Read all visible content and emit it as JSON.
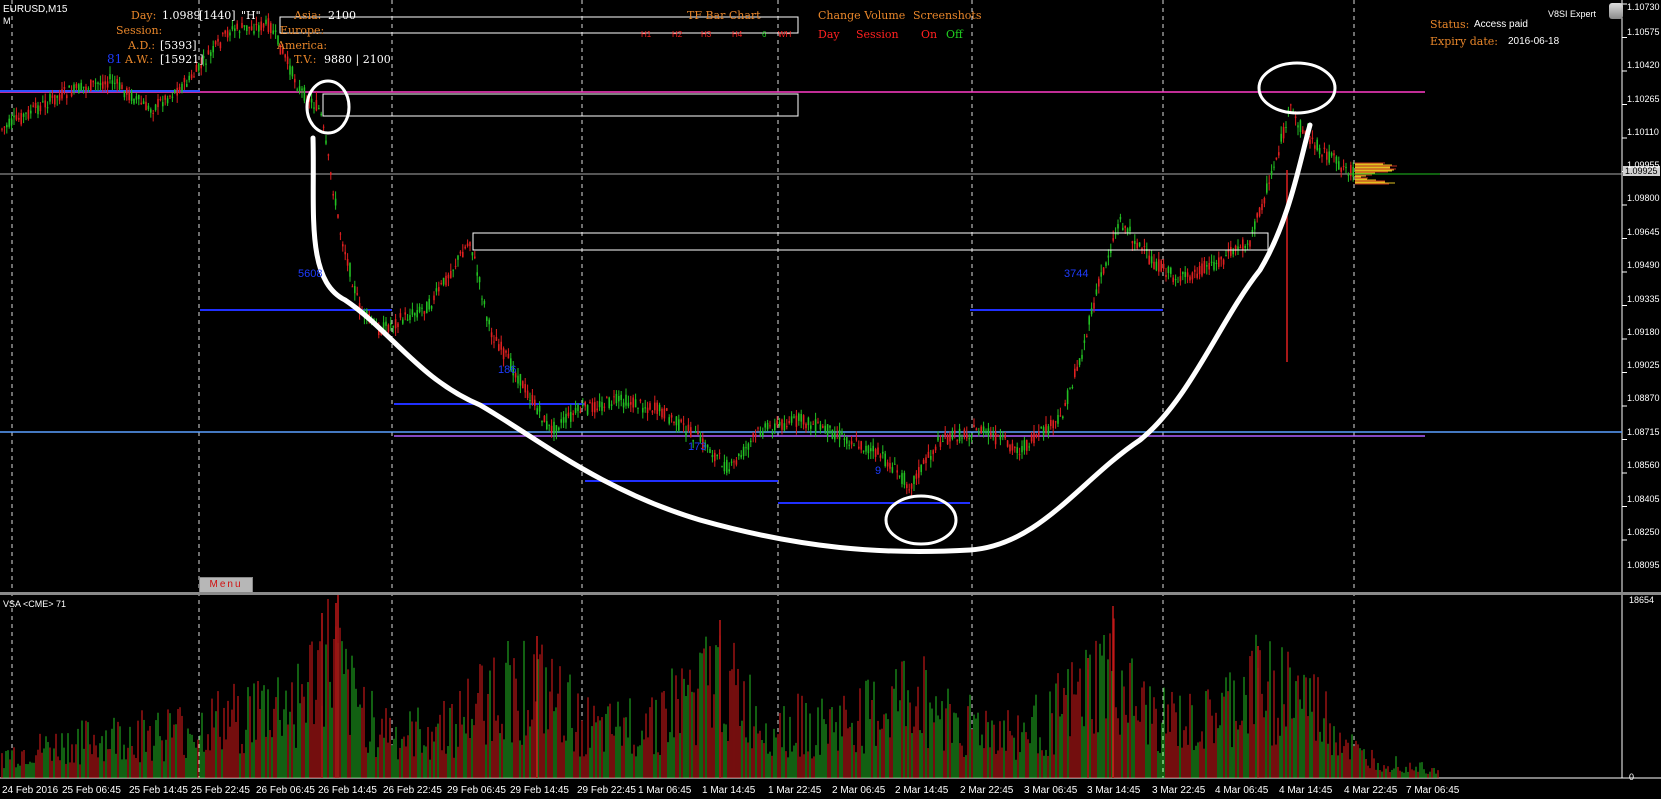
{
  "chart": {
    "symbol": "EURUSD,M15",
    "mode_label": "M",
    "indicator_name": "V8SI Expert",
    "current_price": "1.09925",
    "volume_max": "18654",
    "volume_min": "0"
  },
  "info_panel": {
    "day_label": "Day:",
    "day_value": "1.0989",
    "day_bars": "[1440]",
    "day_h": "\"H\"",
    "session_label": "Session:",
    "ad_label": "A.D.:",
    "ad_value": "[5393]",
    "aw_label": "A.W.:",
    "aw_value": "[15921]",
    "aw_prefix": "81",
    "asia_label": "Asia:",
    "asia_value": "2100",
    "europe_label": "Europe:",
    "america_label": "America:",
    "tv_label": "T.V.:",
    "tv_value": "9880 | 2100"
  },
  "tf_bar_chart": {
    "title": "TF Bar Chart",
    "items": [
      "H1",
      "H2",
      "H3",
      "H4",
      "6",
      "WH"
    ]
  },
  "change_volume": {
    "title": "Change Volume",
    "day": "Day",
    "session": "Session"
  },
  "screenshots": {
    "title": "Screenshots",
    "on": "On",
    "off": "Off"
  },
  "status": {
    "status_label": "Status:",
    "status_value": "Access paid",
    "expiry_label": "Expiry date:",
    "expiry_value": "2016-06-18"
  },
  "chart_labels": {
    "l5608": "5608",
    "l186": "186",
    "l173": "173",
    "l3744": "3744",
    "l9": "9"
  },
  "volume_panel": {
    "title": "VSA <CME> 71"
  },
  "menu_button": "Menu",
  "price_axis": [
    "1.10730",
    "1.10575",
    "1.10420",
    "1.10265",
    "1.10110",
    "1.09955",
    "1.09800",
    "1.09645",
    "1.09490",
    "1.09335",
    "1.09180",
    "1.09025",
    "1.08870",
    "1.08715",
    "1.08560",
    "1.08405",
    "1.08250",
    "1.08095"
  ],
  "time_axis": [
    "24 Feb 2016",
    "25 Feb 06:45",
    "25 Feb 14:45",
    "25 Feb 22:45",
    "26 Feb 06:45",
    "26 Feb 14:45",
    "26 Feb 22:45",
    "29 Feb 06:45",
    "29 Feb 14:45",
    "29 Feb 22:45",
    "1 Mar 06:45",
    "1 Mar 14:45",
    "1 Mar 22:45",
    "2 Mar 06:45",
    "2 Mar 14:45",
    "2 Mar 22:45",
    "3 Mar 06:45",
    "3 Mar 14:45",
    "3 Mar 22:45",
    "4 Mar 06:45",
    "4 Mar 14:45",
    "4 Mar 22:45",
    "7 Mar 06:45"
  ]
}
